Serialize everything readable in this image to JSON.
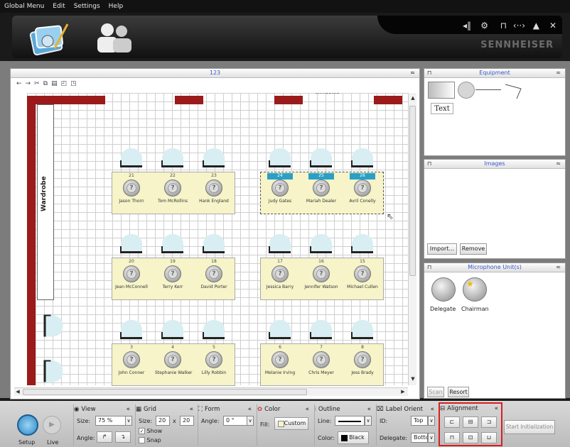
{
  "menu": {
    "items": [
      "Global Menu",
      "Edit",
      "Settings",
      "Help"
    ]
  },
  "header": {
    "brand": "SENNHEISER",
    "icons": [
      "conference-tools-icon",
      "delegate-avatar-icon"
    ],
    "window_controls": [
      "volume-icon",
      "network-icon",
      "lock-icon",
      "remote-icon",
      "up-icon",
      "close-icon"
    ]
  },
  "canvas": {
    "title": "123",
    "window_label": "windows",
    "wardrobe_label": "Wardrobe",
    "toolbar": [
      "back-arrow",
      "forward-arrow",
      "cut",
      "copy",
      "paste",
      "group",
      "ungroup"
    ],
    "tables": [
      {
        "seats": [
          {
            "num": "21",
            "name": "Jason Thorn"
          },
          {
            "num": "22",
            "name": "Tom McRollins"
          },
          {
            "num": "23",
            "name": "Hank England"
          }
        ]
      },
      {
        "seats": [
          {
            "num": "24",
            "name": "Judy Gates",
            "selected": true
          },
          {
            "num": "25",
            "name": "Mariah Dealer",
            "selected": true
          },
          {
            "num": "26",
            "name": "Avril Conelly",
            "selected": true
          }
        ]
      },
      {
        "seats": [
          {
            "num": "20",
            "name": "Jean McConnell"
          },
          {
            "num": "19",
            "name": "Terry Kerr"
          },
          {
            "num": "18",
            "name": "David Porter"
          }
        ]
      },
      {
        "seats": [
          {
            "num": "17",
            "name": "Jessica Barry"
          },
          {
            "num": "16",
            "name": "Jennifer Watson"
          },
          {
            "num": "15",
            "name": "Michael Cullen"
          }
        ]
      },
      {
        "seats": [
          {
            "num": "3",
            "name": "John Conner"
          },
          {
            "num": "4",
            "name": "Stephanie Walker"
          },
          {
            "num": "5",
            "name": "Lilly Robbin"
          }
        ]
      },
      {
        "seats": [
          {
            "num": "6",
            "name": "Melanie Irving"
          },
          {
            "num": "7",
            "name": "Chris Meyer"
          },
          {
            "num": "8",
            "name": "Jess Brady"
          }
        ]
      }
    ]
  },
  "equipment": {
    "title": "Equipment",
    "text_tool": "Text"
  },
  "images": {
    "title": "Images",
    "import_label": "Import...",
    "remove_label": "Remove"
  },
  "mic_units": {
    "title": "Microphone Unit(s)",
    "delegate_label": "Delegate",
    "chairman_label": "Chairman",
    "scan_label": "Scan",
    "resort_label": "Resort"
  },
  "bottom": {
    "setup_label": "Setup",
    "live_label": "Live",
    "view": {
      "title": "View",
      "size_label": "Size:",
      "size_value": "75 %",
      "angle_label": "Angle:"
    },
    "grid": {
      "title": "Grid",
      "size_label": "Size:",
      "size_x": "20",
      "x_label": "x",
      "size_y": "20",
      "show_label": "Show",
      "snap_label": "Snap"
    },
    "form": {
      "title": "Form",
      "angle_label": "Angle:",
      "angle_value": "0 °"
    },
    "color": {
      "title": "Color",
      "fill_label": "Fill:",
      "fill_value": "Custom"
    },
    "outline": {
      "title": "Outline",
      "line_label": "Line:",
      "color_label": "Color:",
      "color_value": "Black"
    },
    "label_orient": {
      "title": "Label Orient",
      "id_label": "ID:",
      "id_value": "Top",
      "delegate_label": "Delegate:",
      "delegate_value": "Bottc"
    },
    "alignment": {
      "title": "Alignment"
    },
    "start_label": "Start Initialization"
  },
  "colors": {
    "wall": "#9b1a1a",
    "table": "#f6f4c8",
    "seat": "#d8eef2",
    "selection": "#2aa0c8",
    "accent_blue": "#3a58c8",
    "alignment_outline": "#d62020"
  }
}
